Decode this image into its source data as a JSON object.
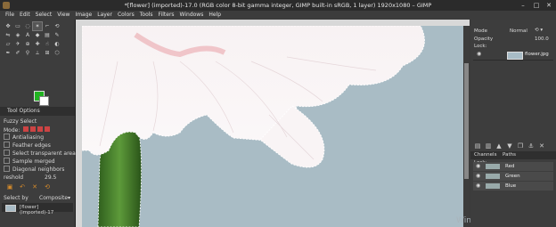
{
  "window": {
    "title": "*[flower] (imported)-17.0 (RGB color 8-bit gamma integer, GIMP built-in sRGB, 1 layer) 1920x1080 – GIMP",
    "controls": [
      "–",
      "□",
      "✕"
    ]
  },
  "menu": [
    "File",
    "Edit",
    "Select",
    "View",
    "Image",
    "Layer",
    "Colors",
    "Tools",
    "Filters",
    "Windows",
    "Help"
  ],
  "colors": {
    "foreground": "#21b321",
    "background": "#ffffff"
  },
  "tool_options": {
    "tab_label": "Tool Options",
    "tool_name": "Fuzzy Select",
    "mode_label": "Mode:",
    "antialiasing": "Antialiasing",
    "feather_edges": "Feather edges",
    "select_transparent": "Select transparent areas",
    "sample_merged": "Sample merged",
    "diagonal_neighbors": "Diagonal neighbors",
    "threshold_label": "reshold",
    "threshold_value": "29.5",
    "threshold_fraction": 0.12,
    "select_by_label": "Select by",
    "select_by_value": "Composite"
  },
  "image_tab": {
    "name": "[flower] (imported)-17"
  },
  "layers_panel": {
    "mode_label": "Mode",
    "mode_value": "Normal",
    "opacity_label": "Opacity",
    "opacity_value": "100.0",
    "lock_label": "Lock:",
    "layer_name": "flower.jpg"
  },
  "channels_panel": {
    "tabs": [
      "Channels",
      "Paths"
    ],
    "lock_label": "Lock:",
    "channels": [
      "Red",
      "Green",
      "Blue"
    ]
  },
  "watermark": "Windows"
}
